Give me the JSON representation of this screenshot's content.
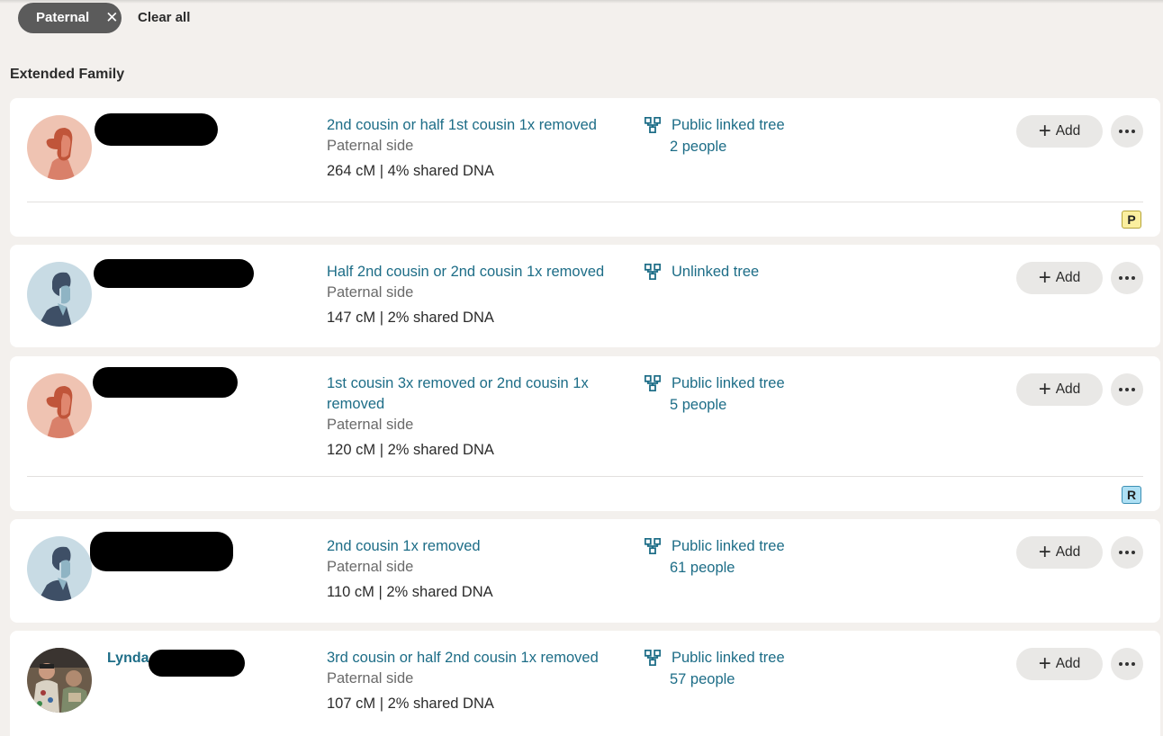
{
  "filters": {
    "active_chip": "Paternal",
    "chip_remove_icon": "close-icon",
    "clear_all_label": "Clear all"
  },
  "section_title": "Extended Family",
  "matches": [
    {
      "name": "",
      "name_redacted": true,
      "avatar": "female-silhouette",
      "relationship": "2nd cousin or half 1st cousin 1x removed",
      "side": "Paternal side",
      "dna": "264 cM | 4% shared DNA",
      "tree_icon": "tree-icon",
      "tree_label": "Public linked tree",
      "tree_people": "2 people",
      "add_label": "Add",
      "tag": "P",
      "tag_color": "#fbef9f"
    },
    {
      "name": "",
      "name_redacted": true,
      "avatar": "male-silhouette",
      "relationship": "Half 2nd cousin or 2nd cousin 1x removed",
      "side": "Paternal side",
      "dna": "147 cM | 2% shared DNA",
      "tree_icon": "tree-icon",
      "tree_label": "Unlinked tree",
      "tree_people": "",
      "add_label": "Add"
    },
    {
      "name": "",
      "name_redacted": true,
      "avatar": "female-silhouette",
      "relationship": "1st cousin 3x removed or 2nd cousin 1x removed",
      "side": "Paternal side",
      "dna": "120 cM | 2% shared DNA",
      "tree_icon": "tree-icon",
      "tree_label": "Public linked tree",
      "tree_people": "5 people",
      "add_label": "Add",
      "tag": "R",
      "tag_color": "#aee0f4"
    },
    {
      "name": "",
      "name_redacted": true,
      "avatar": "male-silhouette",
      "relationship": "2nd cousin 1x removed",
      "side": "Paternal side",
      "dna": "110 cM | 2% shared DNA",
      "tree_icon": "tree-icon",
      "tree_label": "Public linked tree",
      "tree_people": "61 people",
      "add_label": "Add"
    },
    {
      "name": "Lynda",
      "name_redacted": true,
      "avatar": "photo",
      "relationship": "3rd cousin or half 2nd cousin 1x removed",
      "side": "Paternal side",
      "dna": "107 cM | 2% shared DNA",
      "tree_icon": "tree-icon",
      "tree_label": "Public linked tree",
      "tree_people": "57 people",
      "add_label": "Add"
    }
  ],
  "colors": {
    "link": "#1d6d87",
    "background": "#f3f0ed",
    "chip": "#5b5b5b",
    "button": "#e9e8e6"
  }
}
